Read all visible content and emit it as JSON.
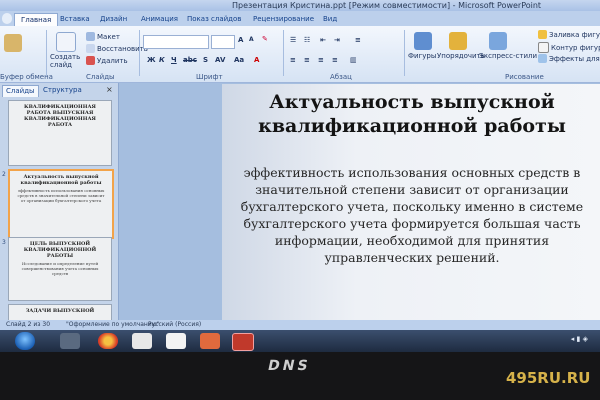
{
  "window": {
    "title": "Презентация Кристина.ppt [Режим совместимости] - Microsoft PowerPoint"
  },
  "tabs": [
    "Главная",
    "Вставка",
    "Дизайн",
    "Анимация",
    "Показ слайдов",
    "Рецензирование",
    "Вид"
  ],
  "ribbon": {
    "clipboard_label": "Буфер обмена",
    "create_slide": "Создать слайд",
    "layout": "Макет",
    "restore": "Восстановить",
    "delete": "Удалить",
    "slides_label": "Слайды",
    "font_label": "Шрифт",
    "paragraph_label": "Абзац",
    "shapes": "Фигуры",
    "arrange": "Упорядочить",
    "quick_styles": "Экспресс-стили",
    "fill": "Заливка фигуры",
    "outline": "Контур фигуры",
    "effects": "Эффекты для фигур",
    "drawing_label": "Рисование"
  },
  "panel": {
    "tabs": [
      "Слайды",
      "Структура"
    ],
    "thumbs": [
      {
        "num": "",
        "title": "КВАЛИФИКАЦИОННАЯ РАБОТА ВЫПУСКНАЯ КВАЛИФИКАЦИОННАЯ РАБОТА",
        "body": ""
      },
      {
        "num": "2",
        "title": "Актуальность выпускной квалификационной работы",
        "body": "эффективность использования основных средств в значительной степени зависит от организации бухгалтерского учета"
      },
      {
        "num": "3",
        "title": "ЦЕЛЬ ВЫПУСКНОЙ КВАЛИФИКАЦИОННОЙ РАБОТЫ",
        "body": "Исследование и определение путей совершенствования учета основных средств"
      },
      {
        "num": "",
        "title": "ЗАДАЧИ ВЫПУСКНОЙ",
        "body": ""
      }
    ]
  },
  "slide": {
    "title": "Актуальность выпускной квалификационной работы",
    "body": "эффективность использования основных средств в значительной степени зависит от организации бухгалтерского учета, поскольку именно в системе бухгалтерского учета формируется большая часть информации, необходимой для принятия управленческих решений."
  },
  "status": {
    "slide": "Слайд 2 из 30",
    "theme": "\"Оформление по умолчанию\"",
    "lang": "Русский (Россия)"
  },
  "bezel": {
    "brand": "DNS"
  },
  "watermark": "495RU.RU"
}
